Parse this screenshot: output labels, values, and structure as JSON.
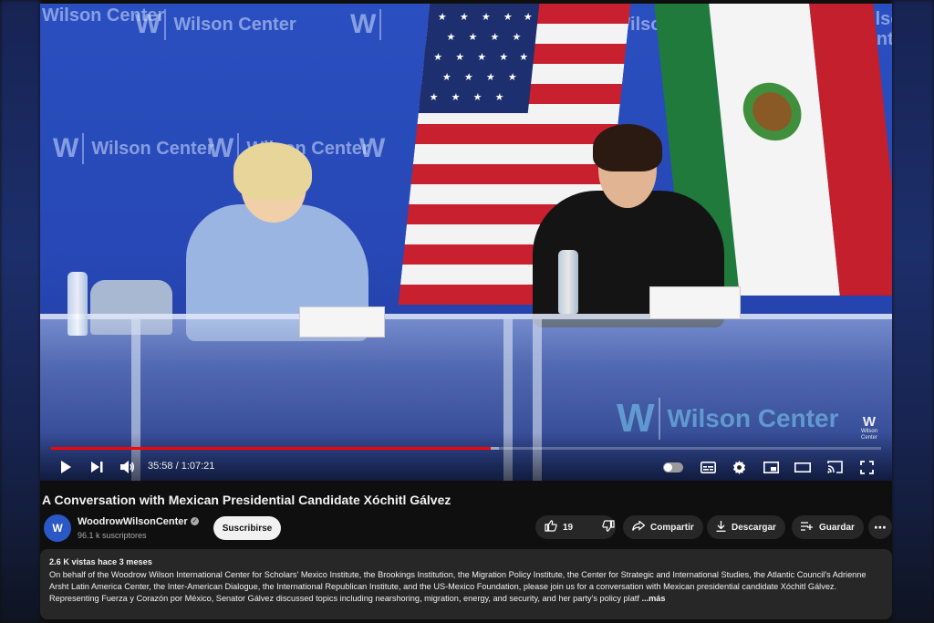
{
  "video": {
    "backdrop_logo_text": "Wilson Center",
    "backdrop_logo_mark": "W",
    "corner_logo_mark": "W",
    "corner_logo_text": "Wilson Center",
    "time_current": "35:58",
    "time_separator": " / ",
    "time_total": "1:07:21",
    "progress_played_fraction": 0.53,
    "progress_loaded_fraction": 0.54,
    "autoplay_on": false
  },
  "title": "A Conversation with Mexican Presidential Candidate Xóchitl Gálvez",
  "channel": {
    "avatar_mark": "W",
    "name": "WoodrowWilsonCenter",
    "verified_mark": "✓",
    "subscribers": "96.1 k suscriptores",
    "subscribe_label": "Suscribirse"
  },
  "actions": {
    "like_count": "19",
    "share_label": "Compartir",
    "download_label": "Descargar",
    "save_label": "Guardar",
    "more_label": "⋯"
  },
  "description": {
    "meta": "2.6 K vistas  hace 3 meses",
    "text": "On behalf of the Woodrow Wilson International Center for Scholars' Mexico Institute, the Brookings Institution, the Migration Policy Institute, the Center for Strategic and International Studies, the Atlantic Council's Adrienne Arsht Latin America Center, the Inter-American Dialogue, the International Republican Institute, and the US-Mexico Foundation, please join us for a conversation with Mexican presidential candidate Xóchitl Gálvez. Representing Fuerza y Corazón por México, Senator Gálvez discussed topics including nearshoring, migration, energy, and security, and her party's policy platf",
    "more_label": "...más"
  },
  "colors": {
    "progress_played": "#ff0000",
    "backdrop_blue": "#2a4fc0",
    "page_bg": "#0f0f0f",
    "pill_bg": "#272727"
  },
  "icons": [
    "play-icon",
    "next-icon",
    "volume-icon",
    "autoplay-toggle",
    "subtitles-icon",
    "settings-gear-icon",
    "miniplayer-icon",
    "theater-mode-icon",
    "cast-icon",
    "fullscreen-icon",
    "like-icon",
    "dislike-icon",
    "share-icon",
    "download-icon",
    "save-playlist-icon",
    "more-icon"
  ]
}
